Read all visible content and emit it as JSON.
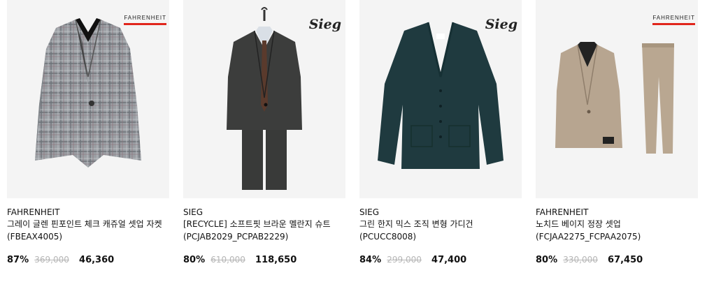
{
  "products": [
    {
      "brand": "FAHRENHEIT",
      "logo_text": "FAHRENHEIT",
      "title": "그레이 글렌 핀포인트 체크 캐쥬얼 셋업 자켓 (FBEAX4005)",
      "discount": "87%",
      "original_price": "369,000",
      "sale_price": "46,360",
      "image_icon": "gray-check-blazer"
    },
    {
      "brand": "SIEG",
      "logo_text": "Sieg",
      "title": "[RECYCLE] 소프트핏 브라운 멜란지 슈트 (PCJAB2029_PCPAB2229)",
      "discount": "80%",
      "original_price": "610,000",
      "sale_price": "118,650",
      "image_icon": "dark-suit-on-hanger"
    },
    {
      "brand": "SIEG",
      "logo_text": "Sieg",
      "title": "그린 한지 믹스 조직 변형 가디건 (PCUCC8008)",
      "discount": "84%",
      "original_price": "299,000",
      "sale_price": "47,400",
      "image_icon": "green-cardigan"
    },
    {
      "brand": "FAHRENHEIT",
      "logo_text": "FAHRENHEIT",
      "title": "노치드 베이지 정장 셋업 (FCJAA2275_FCPAA2075)",
      "discount": "80%",
      "original_price": "330,000",
      "sale_price": "67,450",
      "image_icon": "beige-suit-setup"
    }
  ],
  "colors": {
    "logo_bar": "#e1261c",
    "strike_price": "#b5b5b5",
    "thumb_bg": "#f4f4f4"
  }
}
